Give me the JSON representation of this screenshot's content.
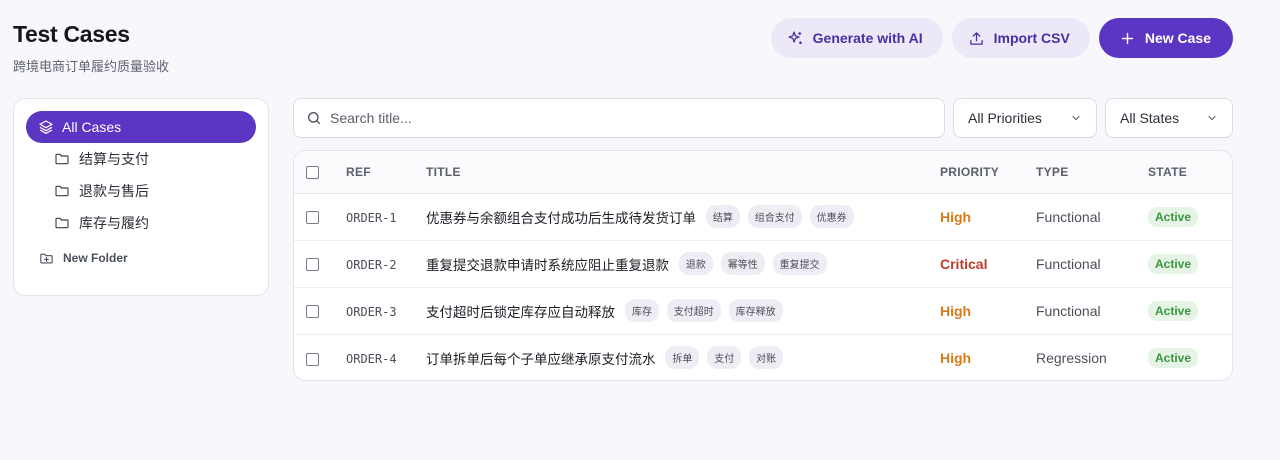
{
  "header": {
    "title": "Test Cases",
    "subtitle": "跨境电商订单履约质量验收"
  },
  "actions": {
    "generate_label": "Generate with AI",
    "import_label": "Import CSV",
    "new_label": "New Case"
  },
  "sidebar": {
    "all_label": "All Cases",
    "folders": [
      "结算与支付",
      "退款与售后",
      "库存与履约"
    ],
    "new_folder_label": "New Folder"
  },
  "search": {
    "placeholder": "Search title..."
  },
  "filters": {
    "priority": "All Priorities",
    "state": "All States"
  },
  "table": {
    "columns": {
      "ref": "REF",
      "title": "TITLE",
      "priority": "PRIORITY",
      "type": "TYPE",
      "state": "STATE"
    },
    "rows": [
      {
        "ref": "ORDER-1",
        "title": "优惠券与余额组合支付成功后生成待发货订单",
        "tags": [
          "结算",
          "组合支付",
          "优惠券"
        ],
        "priority": "High",
        "type": "Functional",
        "state": "Active"
      },
      {
        "ref": "ORDER-2",
        "title": "重复提交退款申请时系统应阻止重复退款",
        "tags": [
          "退款",
          "幂等性",
          "重复提交"
        ],
        "priority": "Critical",
        "type": "Functional",
        "state": "Active"
      },
      {
        "ref": "ORDER-3",
        "title": "支付超时后锁定库存应自动释放",
        "tags": [
          "库存",
          "支付超时",
          "库存释放"
        ],
        "priority": "High",
        "type": "Functional",
        "state": "Active"
      },
      {
        "ref": "ORDER-4",
        "title": "订单拆单后每个子单应继承原支付流水",
        "tags": [
          "拆单",
          "支付",
          "对账"
        ],
        "priority": "High",
        "type": "Regression",
        "state": "Active"
      }
    ]
  },
  "colors": {
    "accent": "#5b35c3",
    "priority_high": "#d97a1a",
    "priority_critical": "#c23a2a",
    "state_active": "#3a9640"
  }
}
